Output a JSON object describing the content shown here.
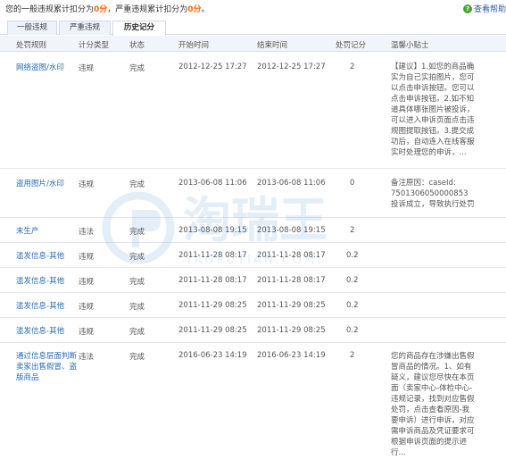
{
  "summary": {
    "prefix": "您的一般违规累计扣分为",
    "general_score": "0分",
    "mid": "，严重违规累计扣分为",
    "serious_score": "0分",
    "suffix": "。"
  },
  "help": {
    "label": "查看帮助"
  },
  "tabs": [
    {
      "label": "一般违规"
    },
    {
      "label": "严重违规"
    },
    {
      "label": "历史记分"
    }
  ],
  "columns": {
    "rule": "处罚规则",
    "type": "计分类型",
    "status": "状态",
    "start": "开始时间",
    "end": "结束时间",
    "score": "处罚记分",
    "tip": "温馨小贴士"
  },
  "rows": [
    {
      "rule": "网络盗图/水印",
      "type": "违规",
      "status": "完成",
      "start": "2012-12-25 17:27",
      "end": "2012-12-25 17:27",
      "score": "2",
      "tip": "【建议】1.如您的商品确实为自己实拍图片，您可以点击申诉按钮。您可以点击申诉按钮。2.如不知道具体哪张图片被投诉，可以进入申诉页面点击违规图提取按钮。3.提交成功后，自动连入在线客服实时处理您的申诉，..."
    },
    {
      "rule": "盗用图片/水印",
      "type": "违规",
      "status": "完成",
      "start": "2013-06-08 11:06",
      "end": "2013-06-08 11:06",
      "score": "0",
      "tip": "备注原因：caseId: 7501306050000853投诉成立，导致执行处罚"
    },
    {
      "rule": "未生产",
      "type": "违法",
      "status": "完成",
      "start": "2013-08-08 19:15",
      "end": "2013-08-08 19:15",
      "score": "2",
      "tip": ""
    },
    {
      "rule": "滥发信息-其他",
      "type": "违规",
      "status": "完成",
      "start": "2011-11-28 08:17",
      "end": "2011-11-28 08:17",
      "score": "0.2",
      "tip": ""
    },
    {
      "rule": "滥发信息-其他",
      "type": "违规",
      "status": "完成",
      "start": "2011-11-28 08:17",
      "end": "2011-11-28 08:17",
      "score": "0.2",
      "tip": ""
    },
    {
      "rule": "滥发信息-其他",
      "type": "违规",
      "status": "完成",
      "start": "2011-11-29 08:25",
      "end": "2011-11-29 08:25",
      "score": "0.2",
      "tip": ""
    },
    {
      "rule": "滥发信息-其他",
      "type": "违规",
      "status": "完成",
      "start": "2011-11-29 08:25",
      "end": "2011-11-29 08:25",
      "score": "0.2",
      "tip": ""
    },
    {
      "rule": "通过信息层面判断卖家出售假冒、盗版商品",
      "type": "违法",
      "status": "完成",
      "start": "2016-06-23 14:19",
      "end": "2016-06-23 14:19",
      "score": "2",
      "tip": "您的商品存在涉嫌出售假冒商品的情况。1、如有疑义，建议您尽快在本页面（卖家中心-体检中心-违规记录，找到对应售假处罚，点击查看原因-我要申诉）进行申诉，对应需申诉商品及凭证要求可根据申诉页面的提示进行..."
    }
  ],
  "watermark": {
    "text": "淘瑞王",
    "sub": "TAOPUTIAN.COM"
  }
}
